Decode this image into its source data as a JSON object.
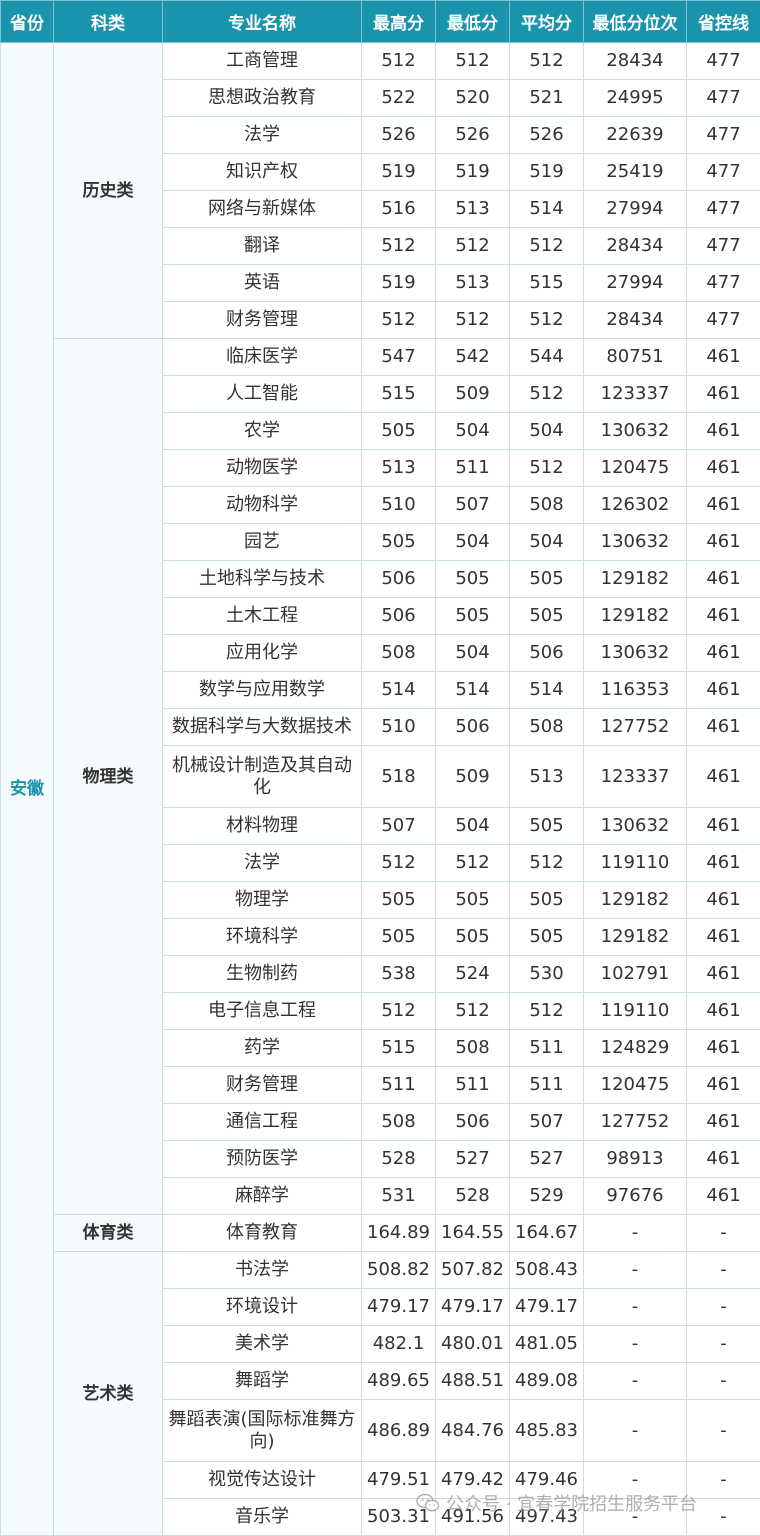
{
  "headers": [
    "省份",
    "科类",
    "专业名称",
    "最高分",
    "最低分",
    "平均分",
    "最低分位次",
    "省控线"
  ],
  "province": "安徽",
  "groups": [
    {
      "category": "历史类",
      "rows": [
        {
          "major": "工商管理",
          "max": "512",
          "min": "512",
          "avg": "512",
          "rank": "28434",
          "line": "477"
        },
        {
          "major": "思想政治教育",
          "max": "522",
          "min": "520",
          "avg": "521",
          "rank": "24995",
          "line": "477"
        },
        {
          "major": "法学",
          "max": "526",
          "min": "526",
          "avg": "526",
          "rank": "22639",
          "line": "477"
        },
        {
          "major": "知识产权",
          "max": "519",
          "min": "519",
          "avg": "519",
          "rank": "25419",
          "line": "477"
        },
        {
          "major": "网络与新媒体",
          "max": "516",
          "min": "513",
          "avg": "514",
          "rank": "27994",
          "line": "477"
        },
        {
          "major": "翻译",
          "max": "512",
          "min": "512",
          "avg": "512",
          "rank": "28434",
          "line": "477"
        },
        {
          "major": "英语",
          "max": "519",
          "min": "513",
          "avg": "515",
          "rank": "27994",
          "line": "477"
        },
        {
          "major": "财务管理",
          "max": "512",
          "min": "512",
          "avg": "512",
          "rank": "28434",
          "line": "477"
        }
      ]
    },
    {
      "category": "物理类",
      "rows": [
        {
          "major": "临床医学",
          "max": "547",
          "min": "542",
          "avg": "544",
          "rank": "80751",
          "line": "461"
        },
        {
          "major": "人工智能",
          "max": "515",
          "min": "509",
          "avg": "512",
          "rank": "123337",
          "line": "461"
        },
        {
          "major": "农学",
          "max": "505",
          "min": "504",
          "avg": "504",
          "rank": "130632",
          "line": "461"
        },
        {
          "major": "动物医学",
          "max": "513",
          "min": "511",
          "avg": "512",
          "rank": "120475",
          "line": "461"
        },
        {
          "major": "动物科学",
          "max": "510",
          "min": "507",
          "avg": "508",
          "rank": "126302",
          "line": "461"
        },
        {
          "major": "园艺",
          "max": "505",
          "min": "504",
          "avg": "504",
          "rank": "130632",
          "line": "461"
        },
        {
          "major": "土地科学与技术",
          "max": "506",
          "min": "505",
          "avg": "505",
          "rank": "129182",
          "line": "461"
        },
        {
          "major": "土木工程",
          "max": "506",
          "min": "505",
          "avg": "505",
          "rank": "129182",
          "line": "461"
        },
        {
          "major": "应用化学",
          "max": "508",
          "min": "504",
          "avg": "506",
          "rank": "130632",
          "line": "461"
        },
        {
          "major": "数学与应用数学",
          "max": "514",
          "min": "514",
          "avg": "514",
          "rank": "116353",
          "line": "461"
        },
        {
          "major": "数据科学与大数据技术",
          "max": "510",
          "min": "506",
          "avg": "508",
          "rank": "127752",
          "line": "461"
        },
        {
          "major": "机械设计制造及其自动化",
          "max": "518",
          "min": "509",
          "avg": "513",
          "rank": "123337",
          "line": "461",
          "tall": true
        },
        {
          "major": "材料物理",
          "max": "507",
          "min": "504",
          "avg": "505",
          "rank": "130632",
          "line": "461"
        },
        {
          "major": "法学",
          "max": "512",
          "min": "512",
          "avg": "512",
          "rank": "119110",
          "line": "461"
        },
        {
          "major": "物理学",
          "max": "505",
          "min": "505",
          "avg": "505",
          "rank": "129182",
          "line": "461"
        },
        {
          "major": "环境科学",
          "max": "505",
          "min": "505",
          "avg": "505",
          "rank": "129182",
          "line": "461"
        },
        {
          "major": "生物制药",
          "max": "538",
          "min": "524",
          "avg": "530",
          "rank": "102791",
          "line": "461"
        },
        {
          "major": "电子信息工程",
          "max": "512",
          "min": "512",
          "avg": "512",
          "rank": "119110",
          "line": "461"
        },
        {
          "major": "药学",
          "max": "515",
          "min": "508",
          "avg": "511",
          "rank": "124829",
          "line": "461"
        },
        {
          "major": "财务管理",
          "max": "511",
          "min": "511",
          "avg": "511",
          "rank": "120475",
          "line": "461"
        },
        {
          "major": "通信工程",
          "max": "508",
          "min": "506",
          "avg": "507",
          "rank": "127752",
          "line": "461"
        },
        {
          "major": "预防医学",
          "max": "528",
          "min": "527",
          "avg": "527",
          "rank": "98913",
          "line": "461"
        },
        {
          "major": "麻醉学",
          "max": "531",
          "min": "528",
          "avg": "529",
          "rank": "97676",
          "line": "461"
        }
      ]
    },
    {
      "category": "体育类",
      "rows": [
        {
          "major": "体育教育",
          "max": "164.89",
          "min": "164.55",
          "avg": "164.67",
          "rank": "-",
          "line": "-"
        }
      ]
    },
    {
      "category": "艺术类",
      "rows": [
        {
          "major": "书法学",
          "max": "508.82",
          "min": "507.82",
          "avg": "508.43",
          "rank": "-",
          "line": "-"
        },
        {
          "major": "环境设计",
          "max": "479.17",
          "min": "479.17",
          "avg": "479.17",
          "rank": "-",
          "line": "-"
        },
        {
          "major": "美术学",
          "max": "482.1",
          "min": "480.01",
          "avg": "481.05",
          "rank": "-",
          "line": "-"
        },
        {
          "major": "舞蹈学",
          "max": "489.65",
          "min": "488.51",
          "avg": "489.08",
          "rank": "-",
          "line": "-"
        },
        {
          "major": "舞蹈表演(国际标准舞方向)",
          "max": "486.89",
          "min": "484.76",
          "avg": "485.83",
          "rank": "-",
          "line": "-",
          "tall": true
        },
        {
          "major": "视觉传达设计",
          "max": "479.51",
          "min": "479.42",
          "avg": "479.46",
          "rank": "-",
          "line": "-"
        },
        {
          "major": "音乐学",
          "max": "503.31",
          "min": "491.56",
          "avg": "497.43",
          "rank": "-",
          "line": "-"
        }
      ]
    }
  ],
  "watermark": {
    "text": "公众号 · 宜春学院招生服务平台",
    "icon": "wechat-icon"
  }
}
